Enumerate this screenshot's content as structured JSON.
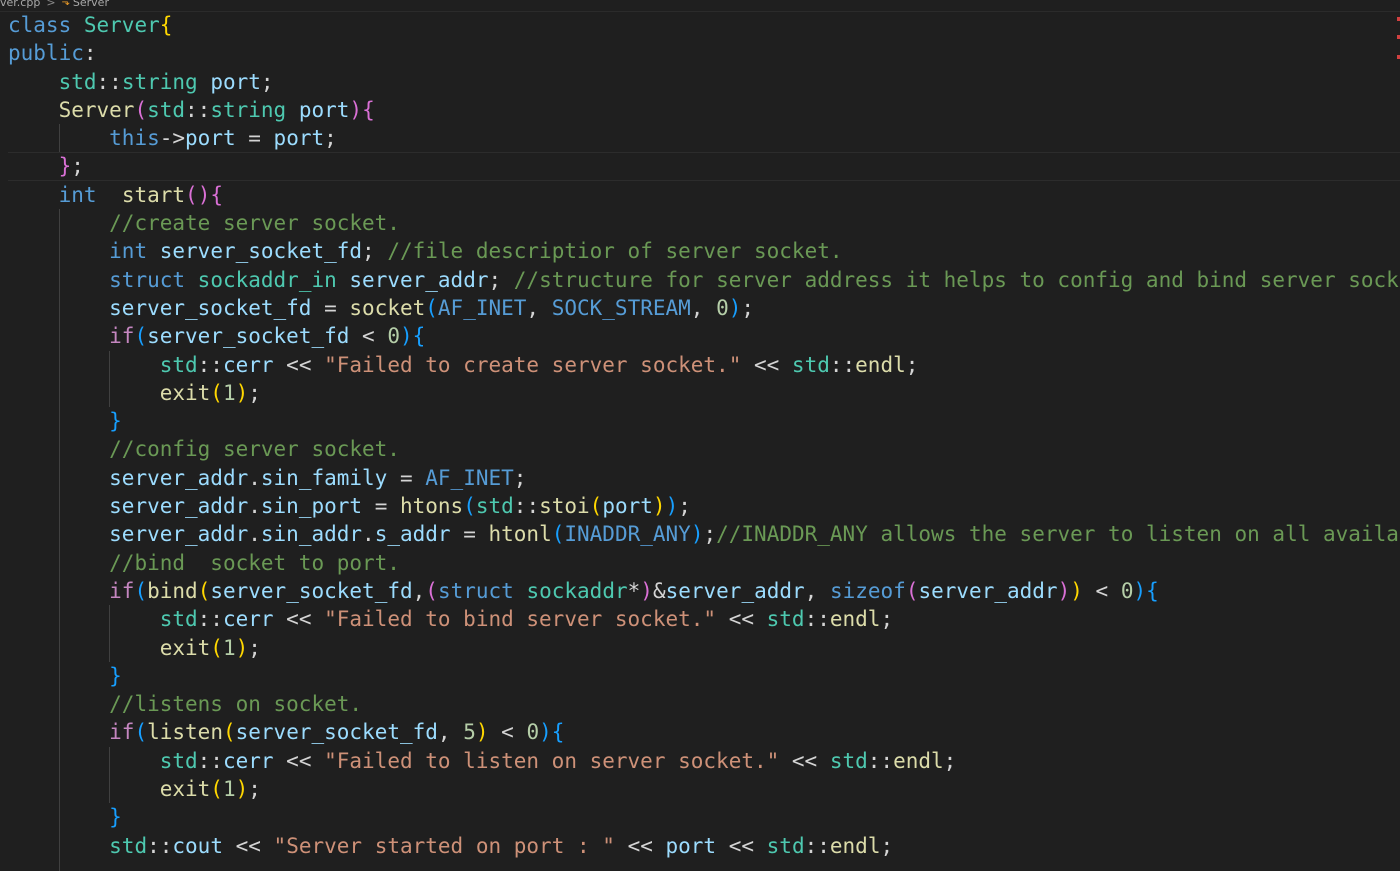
{
  "breadcrumb": {
    "file": "ver.cpp",
    "separator": ">",
    "symbol_icon": "class-symbol-icon",
    "symbol": "Server"
  },
  "colors": {
    "background": "#1f1f1f",
    "keyword": "#569cd6",
    "control": "#c586c0",
    "type": "#4ec9b0",
    "function": "#dcdcaa",
    "variable": "#9cdcfe",
    "number": "#b5cea8",
    "string": "#ce9178",
    "comment": "#6a9955",
    "bracket_level_1": "#ffd700",
    "bracket_level_2": "#da70d6",
    "bracket_level_3": "#179fff"
  },
  "code": {
    "lines": [
      {
        "indent": 0,
        "tokens": [
          [
            "kw",
            "class"
          ],
          [
            "op",
            " "
          ],
          [
            "ty",
            "Server"
          ],
          [
            "b1",
            "{"
          ]
        ]
      },
      {
        "indent": 0,
        "tokens": [
          [
            "kw",
            "public"
          ],
          [
            "op",
            ":"
          ]
        ]
      },
      {
        "indent": 1,
        "tokens": [
          [
            "ty",
            "std"
          ],
          [
            "op",
            "::"
          ],
          [
            "ty",
            "string"
          ],
          [
            "op",
            " "
          ],
          [
            "var",
            "port"
          ],
          [
            "op",
            ";"
          ]
        ]
      },
      {
        "indent": 1,
        "tokens": [
          [
            "fn",
            "Server"
          ],
          [
            "b2",
            "("
          ],
          [
            "ty",
            "std"
          ],
          [
            "op",
            "::"
          ],
          [
            "ty",
            "string"
          ],
          [
            "op",
            " "
          ],
          [
            "var",
            "port"
          ],
          [
            "b2",
            ")"
          ],
          [
            "b2",
            "{"
          ]
        ]
      },
      {
        "indent": 2,
        "tokens": [
          [
            "kw",
            "this"
          ],
          [
            "op",
            "->"
          ],
          [
            "var",
            "port"
          ],
          [
            "op",
            " = "
          ],
          [
            "var",
            "port"
          ],
          [
            "op",
            ";"
          ]
        ]
      },
      {
        "indent": 1,
        "current": true,
        "tokens": [
          [
            "b2",
            "}"
          ],
          [
            "op",
            ";"
          ]
        ]
      },
      {
        "indent": 1,
        "tokens": [
          [
            "kw",
            "int"
          ],
          [
            "op",
            "  "
          ],
          [
            "fn",
            "start"
          ],
          [
            "b2",
            "("
          ],
          [
            "b2",
            ")"
          ],
          [
            "b2",
            "{"
          ]
        ]
      },
      {
        "indent": 2,
        "tokens": [
          [
            "cmt",
            "//create server socket."
          ]
        ]
      },
      {
        "indent": 2,
        "tokens": [
          [
            "kw",
            "int"
          ],
          [
            "op",
            " "
          ],
          [
            "var",
            "server_socket_fd"
          ],
          [
            "op",
            "; "
          ],
          [
            "cmt",
            "//file descriptior of server socket."
          ]
        ]
      },
      {
        "indent": 2,
        "tokens": [
          [
            "kw",
            "struct"
          ],
          [
            "op",
            " "
          ],
          [
            "ty",
            "sockaddr_in"
          ],
          [
            "op",
            " "
          ],
          [
            "var",
            "server_addr"
          ],
          [
            "op",
            "; "
          ],
          [
            "cmt",
            "//structure for server address it helps to config and bind server socket"
          ]
        ]
      },
      {
        "indent": 2,
        "tokens": [
          [
            "var",
            "server_socket_fd"
          ],
          [
            "op",
            " = "
          ],
          [
            "fn",
            "socket"
          ],
          [
            "b3",
            "("
          ],
          [
            "mac",
            "AF_INET"
          ],
          [
            "op",
            ", "
          ],
          [
            "mac",
            "SOCK_STREAM"
          ],
          [
            "op",
            ", "
          ],
          [
            "num",
            "0"
          ],
          [
            "b3",
            ")"
          ],
          [
            "op",
            ";"
          ]
        ]
      },
      {
        "indent": 2,
        "tokens": [
          [
            "ctl",
            "if"
          ],
          [
            "b3",
            "("
          ],
          [
            "var",
            "server_socket_fd"
          ],
          [
            "op",
            " < "
          ],
          [
            "num",
            "0"
          ],
          [
            "b3",
            ")"
          ],
          [
            "b3",
            "{"
          ]
        ]
      },
      {
        "indent": 3,
        "tokens": [
          [
            "ty",
            "std"
          ],
          [
            "op",
            "::"
          ],
          [
            "var",
            "cerr"
          ],
          [
            "op",
            " << "
          ],
          [
            "str",
            "\"Failed to create server socket.\""
          ],
          [
            "op",
            " << "
          ],
          [
            "ty",
            "std"
          ],
          [
            "op",
            "::"
          ],
          [
            "fn",
            "endl"
          ],
          [
            "op",
            ";"
          ]
        ]
      },
      {
        "indent": 3,
        "tokens": [
          [
            "fn",
            "exit"
          ],
          [
            "b1",
            "("
          ],
          [
            "num",
            "1"
          ],
          [
            "b1",
            ")"
          ],
          [
            "op",
            ";"
          ]
        ]
      },
      {
        "indent": 2,
        "tokens": [
          [
            "b3",
            "}"
          ]
        ]
      },
      {
        "indent": 2,
        "tokens": [
          [
            "cmt",
            "//config server socket."
          ]
        ]
      },
      {
        "indent": 2,
        "tokens": [
          [
            "var",
            "server_addr"
          ],
          [
            "op",
            "."
          ],
          [
            "var",
            "sin_family"
          ],
          [
            "op",
            " = "
          ],
          [
            "mac",
            "AF_INET"
          ],
          [
            "op",
            ";"
          ]
        ]
      },
      {
        "indent": 2,
        "tokens": [
          [
            "var",
            "server_addr"
          ],
          [
            "op",
            "."
          ],
          [
            "var",
            "sin_port"
          ],
          [
            "op",
            " = "
          ],
          [
            "fn",
            "htons"
          ],
          [
            "b3",
            "("
          ],
          [
            "ty",
            "std"
          ],
          [
            "op",
            "::"
          ],
          [
            "fn",
            "stoi"
          ],
          [
            "b1",
            "("
          ],
          [
            "var",
            "port"
          ],
          [
            "b1",
            ")"
          ],
          [
            "b3",
            ")"
          ],
          [
            "op",
            ";"
          ]
        ]
      },
      {
        "indent": 2,
        "tokens": [
          [
            "var",
            "server_addr"
          ],
          [
            "op",
            "."
          ],
          [
            "var",
            "sin_addr"
          ],
          [
            "op",
            "."
          ],
          [
            "var",
            "s_addr"
          ],
          [
            "op",
            " = "
          ],
          [
            "fn",
            "htonl"
          ],
          [
            "b3",
            "("
          ],
          [
            "mac",
            "INADDR_ANY"
          ],
          [
            "b3",
            ")"
          ],
          [
            "op",
            ";"
          ],
          [
            "cmt",
            "//INADDR_ANY allows the server to listen on all available"
          ]
        ]
      },
      {
        "indent": 2,
        "tokens": [
          [
            "cmt",
            "//bind  socket to port."
          ]
        ]
      },
      {
        "indent": 2,
        "tokens": [
          [
            "ctl",
            "if"
          ],
          [
            "b3",
            "("
          ],
          [
            "fn",
            "bind"
          ],
          [
            "b1",
            "("
          ],
          [
            "var",
            "server_socket_fd"
          ],
          [
            "op",
            ","
          ],
          [
            "b2",
            "("
          ],
          [
            "kw",
            "struct"
          ],
          [
            "op",
            " "
          ],
          [
            "ty",
            "sockaddr"
          ],
          [
            "op",
            "*"
          ],
          [
            "b2",
            ")"
          ],
          [
            "op",
            "&"
          ],
          [
            "var",
            "server_addr"
          ],
          [
            "op",
            ", "
          ],
          [
            "kw",
            "sizeof"
          ],
          [
            "b2",
            "("
          ],
          [
            "var",
            "server_addr"
          ],
          [
            "b2",
            ")"
          ],
          [
            "b1",
            ")"
          ],
          [
            "op",
            " < "
          ],
          [
            "num",
            "0"
          ],
          [
            "b3",
            ")"
          ],
          [
            "b3",
            "{"
          ]
        ]
      },
      {
        "indent": 3,
        "tokens": [
          [
            "ty",
            "std"
          ],
          [
            "op",
            "::"
          ],
          [
            "var",
            "cerr"
          ],
          [
            "op",
            " << "
          ],
          [
            "str",
            "\"Failed to bind server socket.\""
          ],
          [
            "op",
            " << "
          ],
          [
            "ty",
            "std"
          ],
          [
            "op",
            "::"
          ],
          [
            "fn",
            "endl"
          ],
          [
            "op",
            ";"
          ]
        ]
      },
      {
        "indent": 3,
        "tokens": [
          [
            "fn",
            "exit"
          ],
          [
            "b1",
            "("
          ],
          [
            "num",
            "1"
          ],
          [
            "b1",
            ")"
          ],
          [
            "op",
            ";"
          ]
        ]
      },
      {
        "indent": 2,
        "tokens": [
          [
            "b3",
            "}"
          ]
        ]
      },
      {
        "indent": 2,
        "tokens": [
          [
            "cmt",
            "//listens on socket."
          ]
        ]
      },
      {
        "indent": 2,
        "tokens": [
          [
            "ctl",
            "if"
          ],
          [
            "b3",
            "("
          ],
          [
            "fn",
            "listen"
          ],
          [
            "b1",
            "("
          ],
          [
            "var",
            "server_socket_fd"
          ],
          [
            "op",
            ", "
          ],
          [
            "num",
            "5"
          ],
          [
            "b1",
            ")"
          ],
          [
            "op",
            " < "
          ],
          [
            "num",
            "0"
          ],
          [
            "b3",
            ")"
          ],
          [
            "b3",
            "{"
          ]
        ]
      },
      {
        "indent": 3,
        "tokens": [
          [
            "ty",
            "std"
          ],
          [
            "op",
            "::"
          ],
          [
            "var",
            "cerr"
          ],
          [
            "op",
            " << "
          ],
          [
            "str",
            "\"Failed to listen on server socket.\""
          ],
          [
            "op",
            " << "
          ],
          [
            "ty",
            "std"
          ],
          [
            "op",
            "::"
          ],
          [
            "fn",
            "endl"
          ],
          [
            "op",
            ";"
          ]
        ]
      },
      {
        "indent": 3,
        "tokens": [
          [
            "fn",
            "exit"
          ],
          [
            "b1",
            "("
          ],
          [
            "num",
            "1"
          ],
          [
            "b1",
            ")"
          ],
          [
            "op",
            ";"
          ]
        ]
      },
      {
        "indent": 2,
        "tokens": [
          [
            "b3",
            "}"
          ]
        ]
      },
      {
        "indent": 2,
        "tokens": [
          [
            "ty",
            "std"
          ],
          [
            "op",
            "::"
          ],
          [
            "var",
            "cout"
          ],
          [
            "op",
            " << "
          ],
          [
            "str",
            "\"Server started on port : \""
          ],
          [
            "op",
            " << "
          ],
          [
            "var",
            "port"
          ],
          [
            "op",
            " << "
          ],
          [
            "ty",
            "std"
          ],
          [
            "op",
            "::"
          ],
          [
            "fn",
            "endl"
          ],
          [
            "op",
            ";"
          ]
        ]
      },
      {
        "indent": 2,
        "tokens": []
      }
    ]
  }
}
